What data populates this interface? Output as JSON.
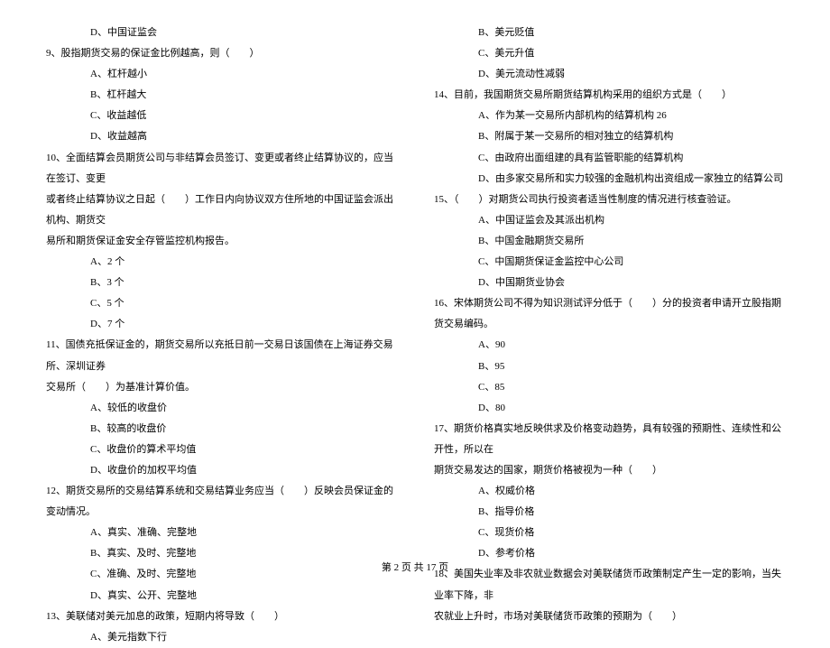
{
  "left": {
    "q8optD": "D、中国证监会",
    "q9": "9、股指期货交易的保证金比例越高，则（　　）",
    "q9A": "A、杠杆越小",
    "q9B": "B、杠杆越大",
    "q9C": "C、收益越低",
    "q9D": "D、收益越高",
    "q10l1": "10、全面结算会员期货公司与非结算会员签订、变更或者终止结算协议的，应当在签订、变更",
    "q10l2": "或者终止结算协议之日起（　　）工作日内向协议双方住所地的中国证监会派出机构、期货交",
    "q10l3": "易所和期货保证金安全存管监控机构报告。",
    "q10A": "A、2 个",
    "q10B": "B、3 个",
    "q10C": "C、5 个",
    "q10D": "D、7 个",
    "q11l1": "11、国债充抵保证金的，期货交易所以充抵日前一交易日该国债在上海证券交易所、深圳证券",
    "q11l2": "交易所（　　）为基准计算价值。",
    "q11A": "A、较低的收盘价",
    "q11B": "B、较高的收盘价",
    "q11C": "C、收盘价的算术平均值",
    "q11D": "D、收盘价的加权平均值",
    "q12": "12、期货交易所的交易结算系统和交易结算业务应当（　　）反映会员保证金的变动情况。",
    "q12A": "A、真实、准确、完整地",
    "q12B": "B、真实、及时、完整地",
    "q12C": "C、准确、及时、完整地",
    "q12D": "D、真实、公开、完整地",
    "q13": "13、美联储对美元加息的政策，短期内将导致（　　）",
    "q13A": "A、美元指数下行"
  },
  "right": {
    "q13B": "B、美元贬值",
    "q13C": "C、美元升值",
    "q13D": "D、美元流动性减弱",
    "q14": "14、目前，我国期货交易所期货结算机构采用的组织方式是（　　）",
    "q14A": "A、作为某一交易所内部机构的结算机构 26",
    "q14B": "B、附属于某一交易所的相对独立的结算机构",
    "q14C": "C、由政府出面组建的具有监管职能的结算机构",
    "q14D": "D、由多家交易所和实力较强的金融机构出资组成一家独立的结算公司",
    "q15": "15、（　　）对期货公司执行投资者适当性制度的情况进行核查验证。",
    "q15A": "A、中国证监会及其派出机构",
    "q15B": "B、中国金融期货交易所",
    "q15C": "C、中国期货保证金监控中心公司",
    "q15D": "D、中国期货业协会",
    "q16": "16、宋体期货公司不得为知识测试评分低于（　　）分的投资者申请开立股指期货交易编码。",
    "q16A": "A、90",
    "q16B": "B、95",
    "q16C": "C、85",
    "q16D": "D、80",
    "q17l1": "17、期货价格真实地反映供求及价格变动趋势，具有较强的预期性、连续性和公开性，所以在",
    "q17l2": "期货交易发达的国家，期货价格被视为一种（　　）",
    "q17A": "A、权威价格",
    "q17B": "B、指导价格",
    "q17C": "C、现货价格",
    "q17D": "D、参考价格",
    "q18l1": "18、美国失业率及非农就业数据会对美联储货币政策制定产生一定的影响，当失业率下降，非",
    "q18l2": "农就业上升时，市场对美联储货币政策的预期为（　　）"
  },
  "footer": "第 2 页 共 17 页"
}
